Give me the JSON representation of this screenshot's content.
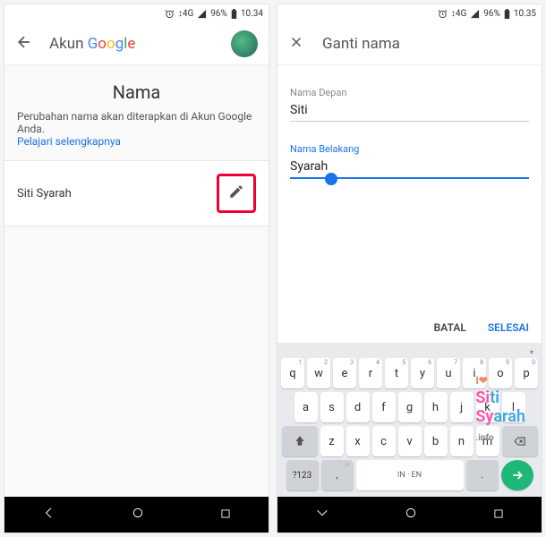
{
  "left": {
    "status": {
      "network": "4G",
      "battery": "96%",
      "time": "10.34"
    },
    "appbar": {
      "title_prefix": "Akun ",
      "brand": "Google"
    },
    "section": {
      "heading": "Nama",
      "desc": "Perubahan nama akan diterapkan di Akun Google Anda.",
      "link": "Pelajari selengkapnya",
      "name_value": "Siti Syarah"
    }
  },
  "right": {
    "status": {
      "network": "4G",
      "battery": "96%",
      "time": "10.35"
    },
    "appbar": {
      "title": "Ganti nama"
    },
    "form": {
      "first_label": "Nama Depan",
      "first_value": "Siti",
      "last_label": "Nama Belakang",
      "last_value": "Syarah"
    },
    "actions": {
      "cancel": "BATAL",
      "done": "SELESAI"
    },
    "keyboard": {
      "row1": [
        "q",
        "w",
        "e",
        "r",
        "t",
        "y",
        "u",
        "i",
        "o",
        "p"
      ],
      "sup1": [
        "1",
        "2",
        "3",
        "4",
        "5",
        "6",
        "7",
        "8",
        "9",
        "0"
      ],
      "row2": [
        "a",
        "s",
        "d",
        "f",
        "g",
        "h",
        "j",
        "k",
        "l"
      ],
      "row3": [
        "z",
        "x",
        "c",
        "v",
        "b",
        "n",
        "m"
      ],
      "sym": "?123",
      "space": "IN · EN"
    }
  }
}
